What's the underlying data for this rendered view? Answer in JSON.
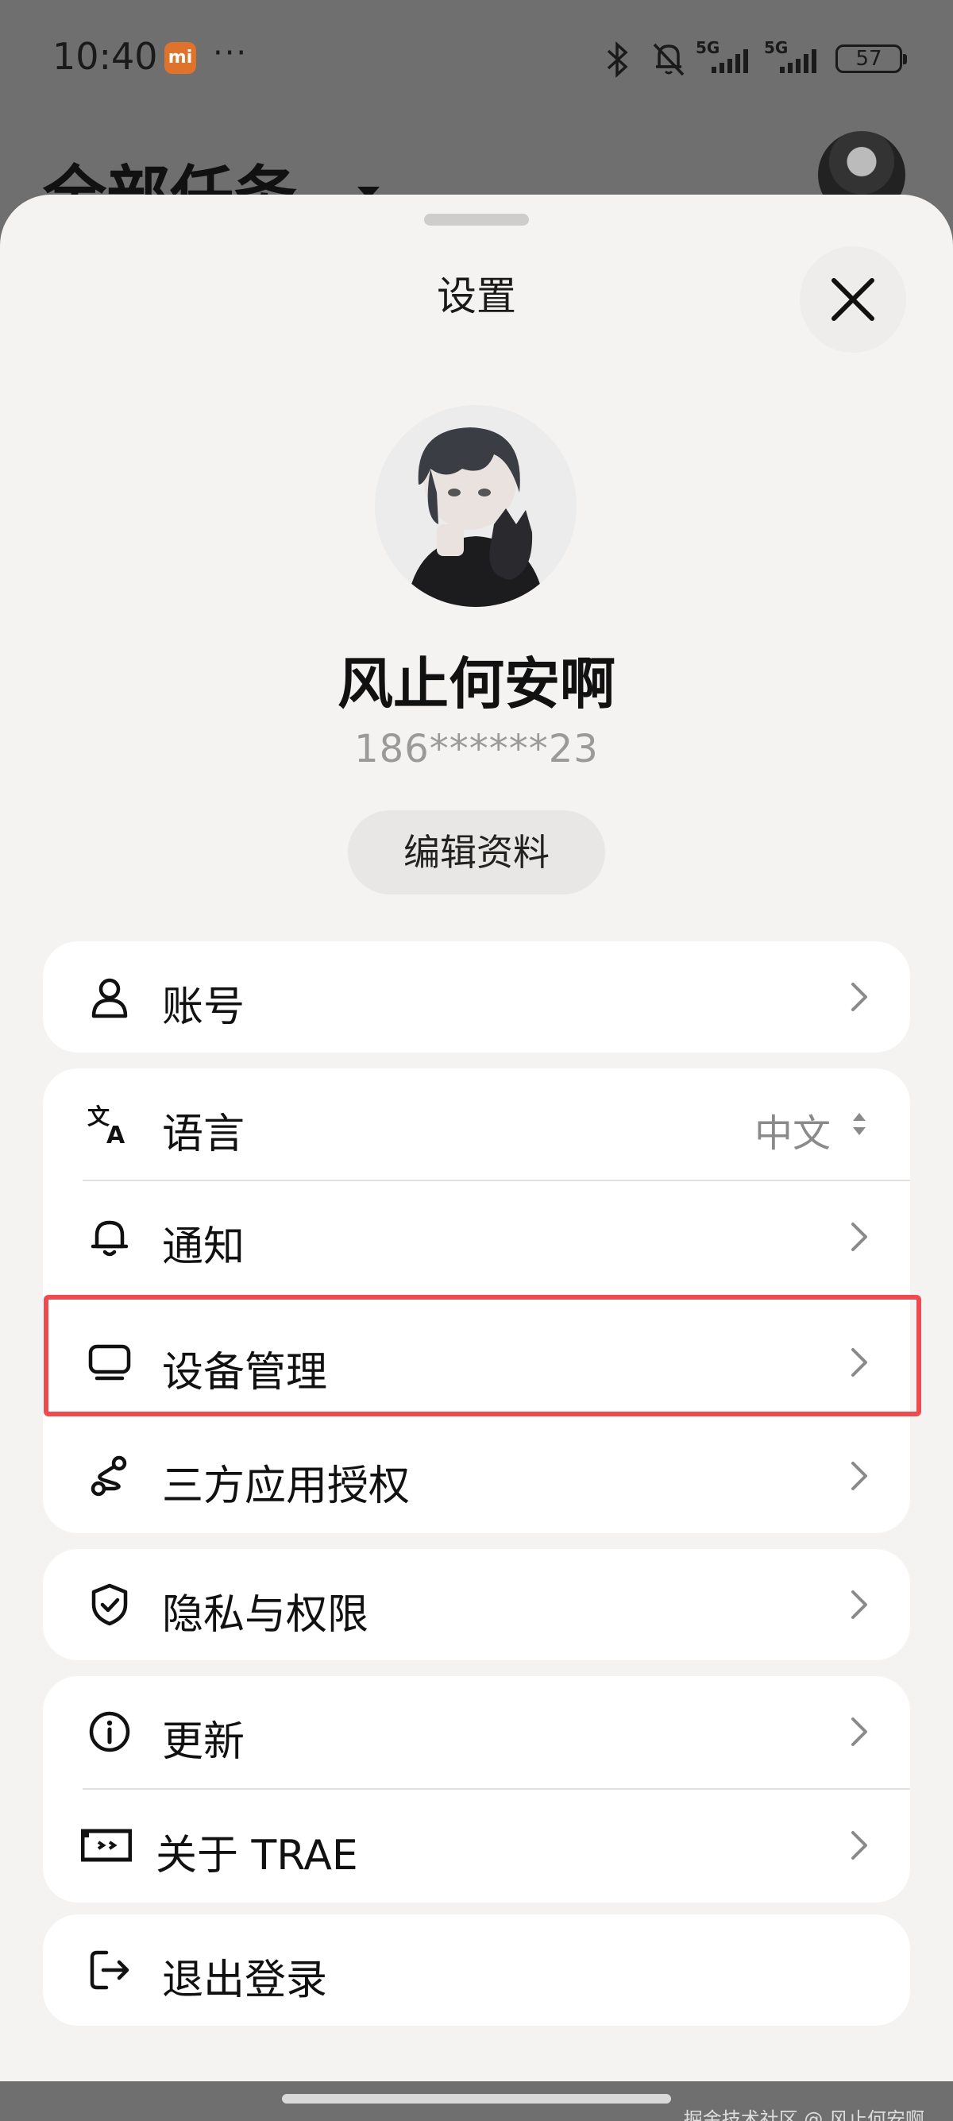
{
  "status_bar": {
    "time": "10:40",
    "badge": "mi",
    "dots": "···",
    "network_1": "5G",
    "network_2": "5G",
    "battery": "57"
  },
  "background": {
    "title": "全部任务"
  },
  "sheet": {
    "title": "设置",
    "user": {
      "name": "风止何安啊",
      "phone": "186******23",
      "edit_label": "编辑资料"
    },
    "groups": [
      {
        "items": [
          {
            "label": "账号",
            "icon": "person-icon"
          }
        ]
      },
      {
        "items": [
          {
            "label": "语言",
            "icon": "translate-icon",
            "value": "中文"
          },
          {
            "label": "通知",
            "icon": "bell-icon"
          },
          {
            "label": "设备管理",
            "icon": "monitor-icon"
          },
          {
            "label": "三方应用授权",
            "icon": "share-nodes-icon"
          }
        ]
      },
      {
        "items": [
          {
            "label": "隐私与权限",
            "icon": "shield-check-icon"
          }
        ]
      },
      {
        "items": [
          {
            "label": "更新",
            "icon": "info-icon"
          },
          {
            "label": "关于 TRAE",
            "icon": "trae-logo-icon"
          }
        ]
      },
      {
        "items": [
          {
            "label": "退出登录",
            "icon": "logout-icon"
          }
        ]
      }
    ]
  },
  "highlight_color": "#ee4b50",
  "watermark": "掘金技术社区 @ 风止何安啊"
}
